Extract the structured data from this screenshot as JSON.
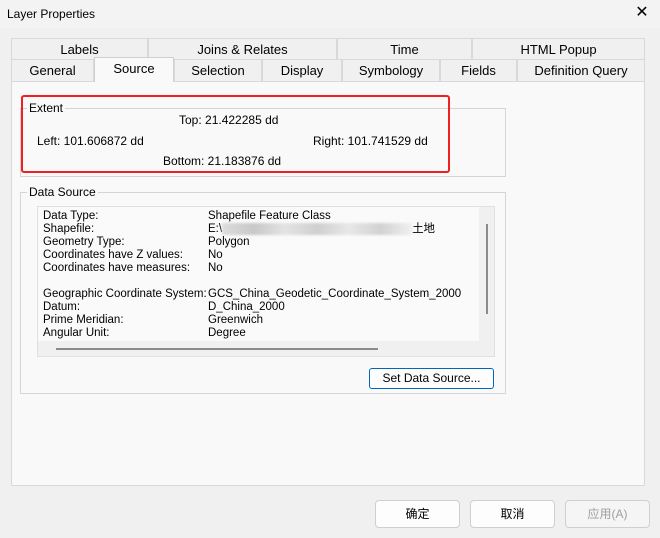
{
  "window": {
    "title": "Layer Properties",
    "close": "✕"
  },
  "tabs_row1": [
    "Labels",
    "Joins & Relates",
    "Time",
    "HTML Popup"
  ],
  "tabs_row2": [
    "General",
    "Source",
    "Selection",
    "Display",
    "Symbology",
    "Fields",
    "Definition Query"
  ],
  "active_tab": "Source",
  "extent": {
    "label": "Extent",
    "top": "Top:  21.422285 dd",
    "left": "Left: 101.606872 dd",
    "right": "Right:  101.741529 dd",
    "bottom": "Bottom:  21.183876 dd"
  },
  "data_source": {
    "label": "Data Source",
    "rows": [
      {
        "k": "Data Type:",
        "v": "Shapefile Feature Class"
      },
      {
        "k": "Shapefile:",
        "v": "E:\\",
        "v_end": "土地"
      },
      {
        "k": "Geometry Type:",
        "v": "Polygon"
      },
      {
        "k": "Coordinates have Z values:",
        "v": "No"
      },
      {
        "k": "Coordinates have measures:",
        "v": "No"
      },
      {
        "k": "Geographic Coordinate System:",
        "v": "GCS_China_Geodetic_Coordinate_System_2000"
      },
      {
        "k": "Datum:",
        "v": "D_China_2000"
      },
      {
        "k": "Prime Meridian:",
        "v": "Greenwich"
      },
      {
        "k": "Angular Unit:",
        "v": "Degree"
      }
    ],
    "set_button": "Set Data Source..."
  },
  "buttons": {
    "ok": "确定",
    "cancel": "取消",
    "apply": "应用(A)"
  },
  "colors": {
    "highlight": "#f02020"
  }
}
